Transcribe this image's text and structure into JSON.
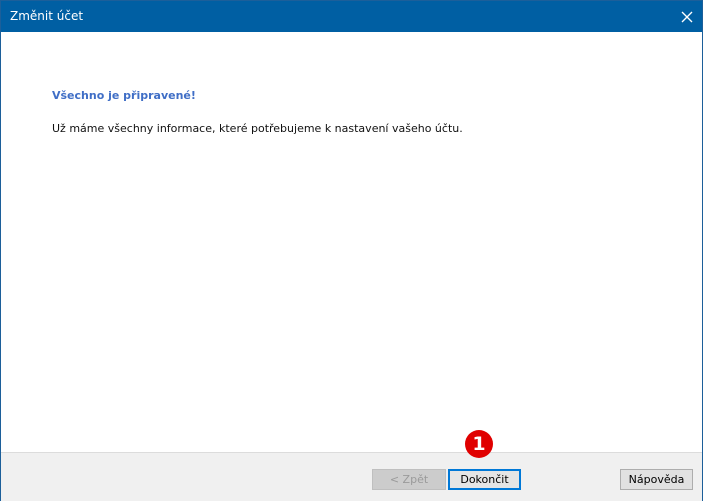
{
  "window": {
    "title": "Změnit účet",
    "close_icon": "close-icon"
  },
  "content": {
    "heading": "Všechno je připravené!",
    "message": "Už máme všechny informace, které potřebujeme k nastavení vašeho účtu."
  },
  "footer": {
    "back_label": "< Zpět",
    "finish_label": "Dokončit",
    "help_label": "Nápověda"
  },
  "annotation": {
    "badge_number": "1",
    "badge_color": "#e00000"
  },
  "colors": {
    "titlebar": "#005fa3",
    "heading": "#3f6ec6",
    "default_button_border": "#0078d7"
  }
}
